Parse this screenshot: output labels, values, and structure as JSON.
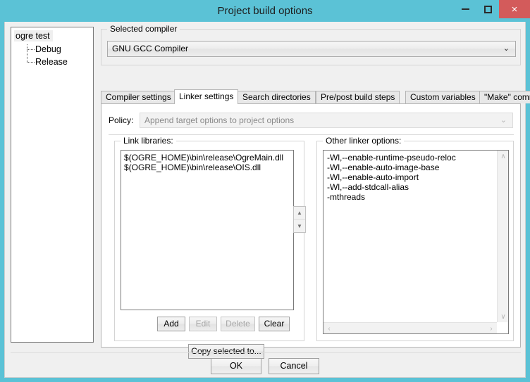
{
  "window": {
    "title": "Project build options",
    "minimize_label": "–",
    "maximize_label": "",
    "close_label": "×",
    "titlebar_color": "#5BC2D6",
    "close_button_color": "#D35B5B"
  },
  "tree": {
    "root": {
      "label": "ogre test",
      "selected": true
    },
    "children": [
      {
        "label": "Debug"
      },
      {
        "label": "Release"
      }
    ]
  },
  "compiler": {
    "group_title": "Selected compiler",
    "selected": "GNU GCC Compiler",
    "arrow": "⌄"
  },
  "tabs": [
    {
      "label": "Compiler settings",
      "active": false
    },
    {
      "label": "Linker settings",
      "active": true
    },
    {
      "label": "Search directories",
      "active": false
    },
    {
      "label": "Pre/post build steps",
      "active": false
    },
    {
      "label": "Custom variables",
      "active": false
    },
    {
      "label": "\"Make\" commands",
      "active": false
    }
  ],
  "policy": {
    "label": "Policy:",
    "value": "Append target options to project options",
    "disabled": true,
    "arrow": "⌄"
  },
  "link_libraries": {
    "group_title": "Link libraries:",
    "items": [
      "$(OGRE_HOME)\\bin\\release\\OgreMain.dll",
      "$(OGRE_HOME)\\bin\\release\\OIS.dll"
    ],
    "buttons": {
      "add": "Add",
      "edit": "Edit",
      "delete": "Delete",
      "clear": "Clear",
      "copy_selected_to": "Copy selected to..."
    },
    "buttons_disabled": [
      "edit",
      "delete"
    ]
  },
  "reorder": {
    "up": "▲",
    "down": "▼"
  },
  "other_linker_options": {
    "group_title": "Other linker options:",
    "lines": [
      "-Wl,--enable-runtime-pseudo-reloc",
      "-Wl,--enable-auto-image-base",
      "-Wl,--enable-auto-import",
      "-Wl,--add-stdcall-alias",
      "-mthreads"
    ],
    "scroll_up": "∧",
    "scroll_down": "∨",
    "scroll_left": "‹",
    "scroll_right": "›"
  },
  "dialog_buttons": {
    "ok": "OK",
    "cancel": "Cancel"
  }
}
